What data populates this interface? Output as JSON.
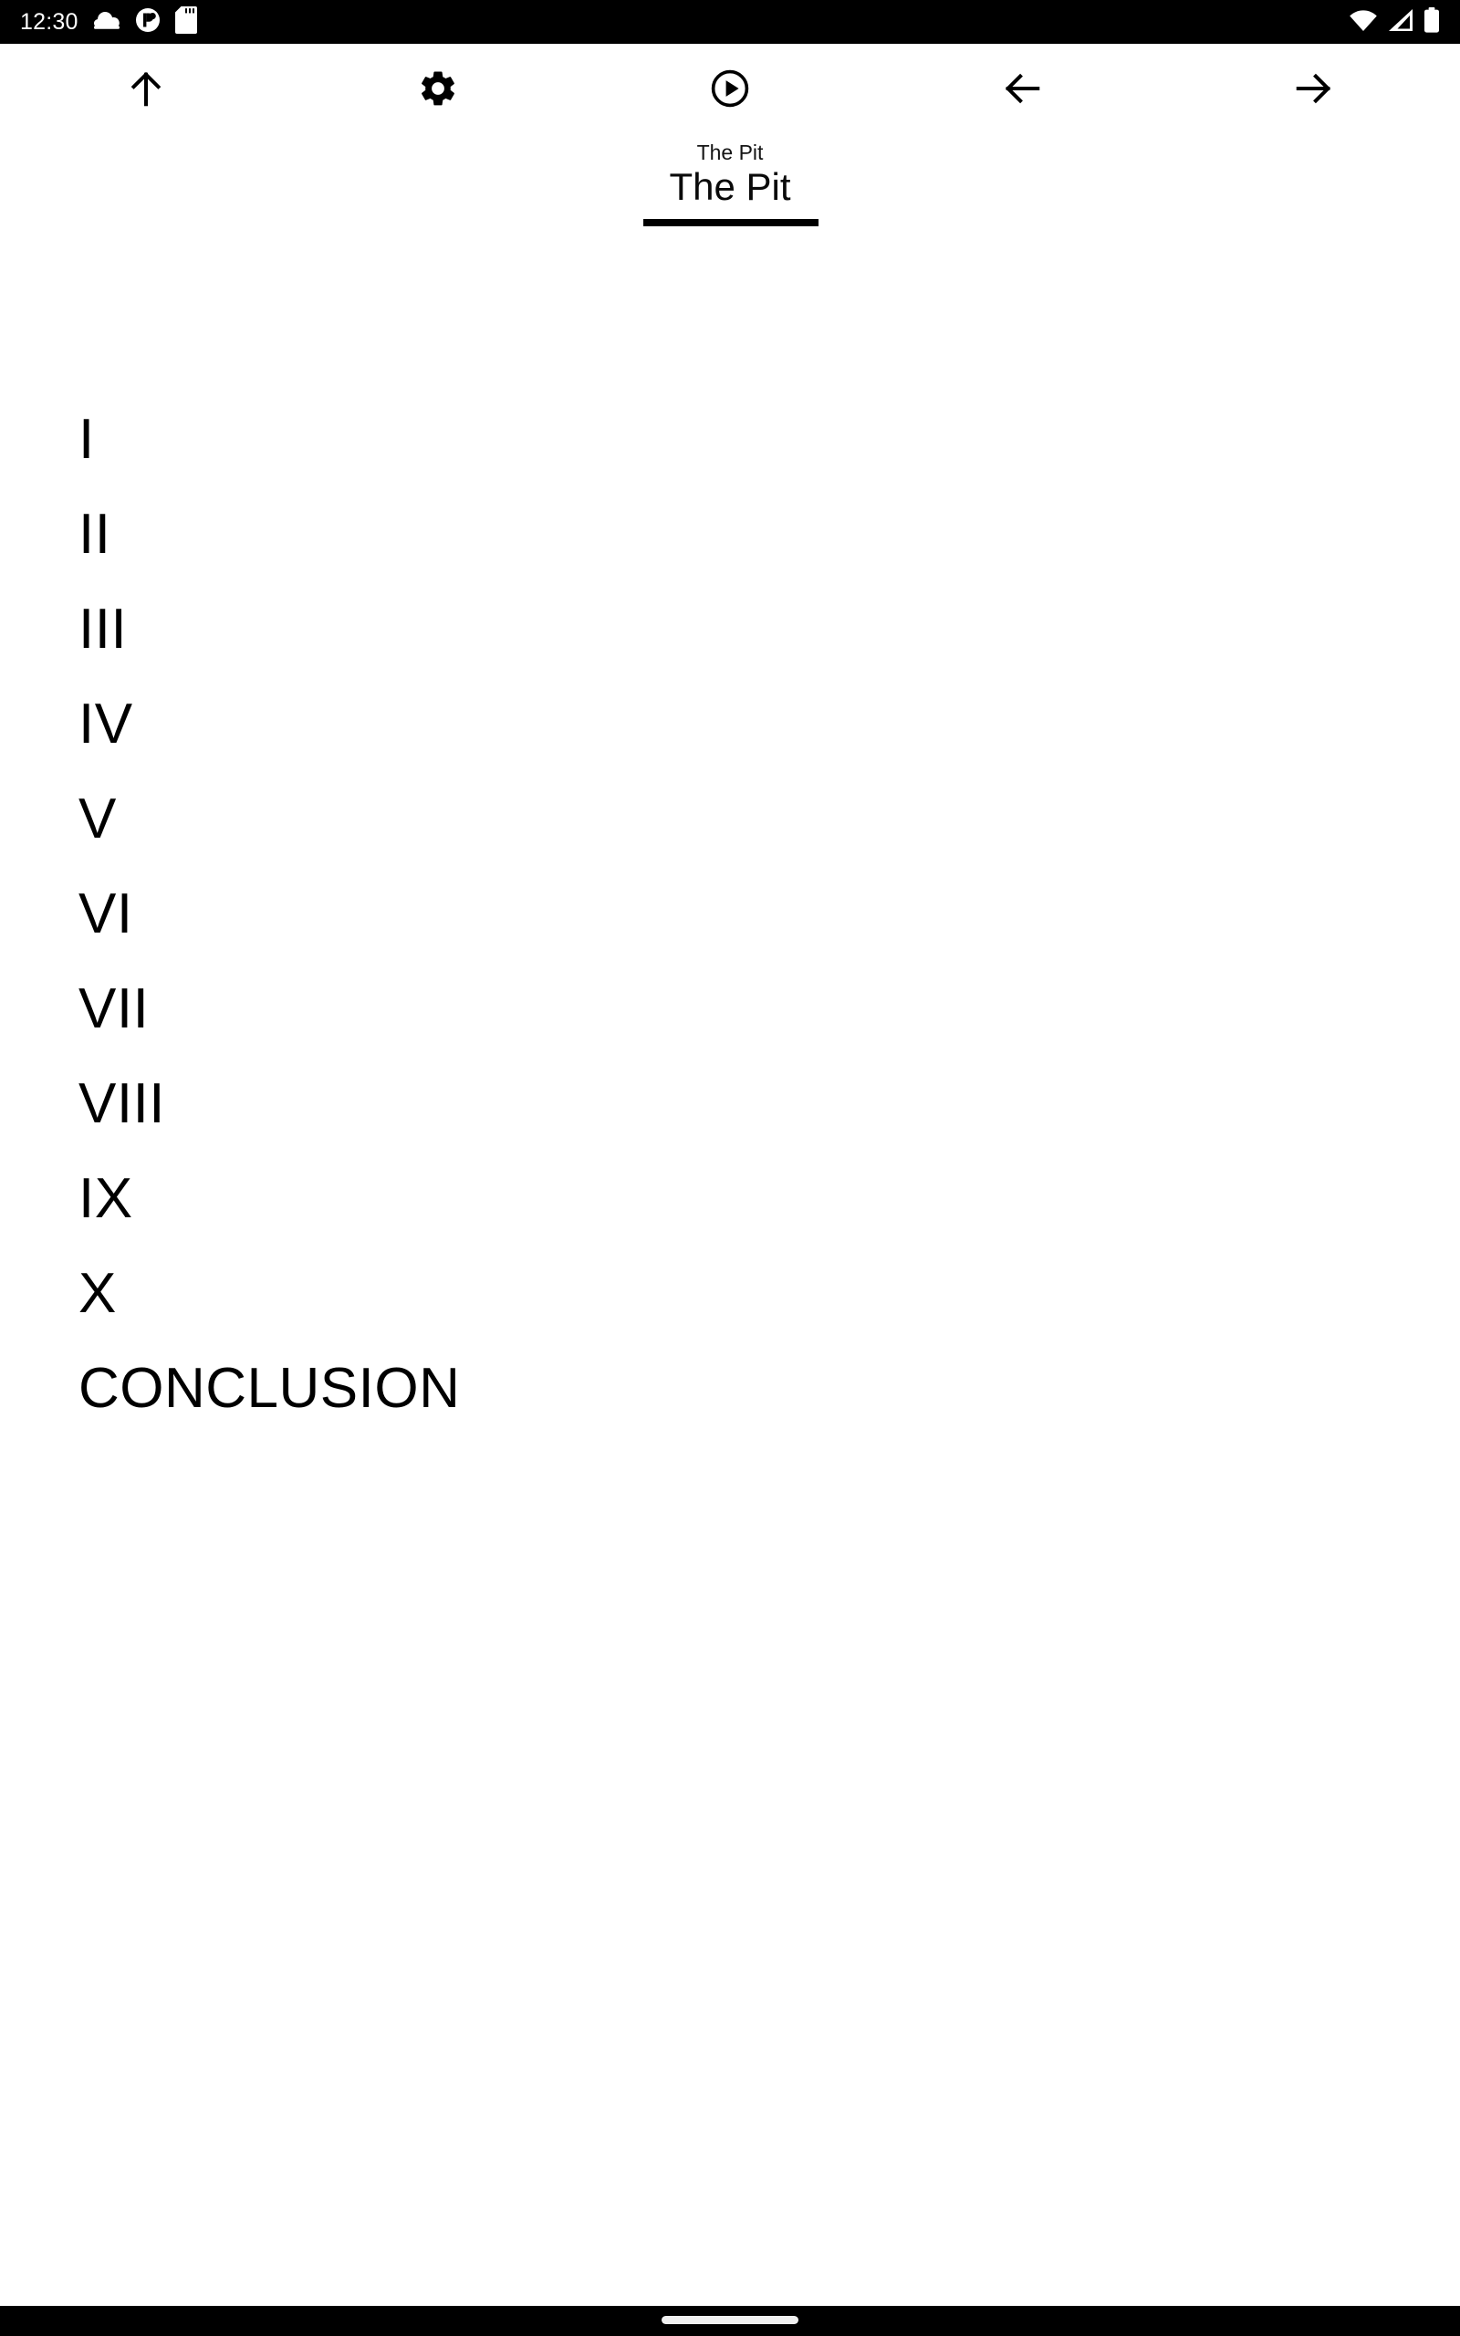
{
  "status_bar": {
    "time": "12:30",
    "left_icons": [
      "cloud-icon",
      "notification-circle-icon",
      "sd-card-icon"
    ],
    "right_icons": [
      "wifi-icon",
      "cellular-signal-icon",
      "battery-icon"
    ],
    "background_color": "#000000",
    "foreground_color": "#ffffff"
  },
  "toolbar": {
    "items": [
      {
        "name": "scroll-to-top-button",
        "icon": "arrow-up-icon",
        "label": "Scroll to top"
      },
      {
        "name": "settings-button",
        "icon": "gear-icon",
        "label": "Settings"
      },
      {
        "name": "play-button",
        "icon": "play-circle-icon",
        "label": "Play"
      },
      {
        "name": "back-button",
        "icon": "arrow-left-icon",
        "label": "Back"
      },
      {
        "name": "forward-button",
        "icon": "arrow-right-icon",
        "label": "Forward"
      }
    ]
  },
  "header": {
    "book_title": "The Pit",
    "active_tab": "The Pit"
  },
  "contents": {
    "chapters": [
      "I",
      "II",
      "III",
      "IV",
      "V",
      "VI",
      "VII",
      "VIII",
      "IX",
      "X",
      "CONCLUSION"
    ]
  },
  "nav_bar": {
    "gesture_pill": "home-indicator",
    "background_color": "#000000",
    "pill_color": "#f1f1f1"
  },
  "theme": {
    "background": "#ffffff",
    "text": "#000000",
    "accent": "#000000"
  }
}
